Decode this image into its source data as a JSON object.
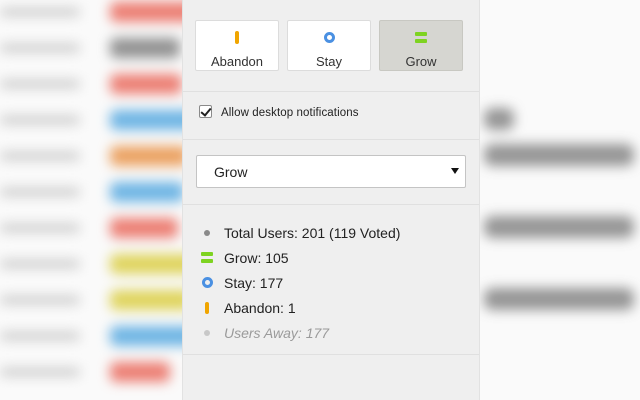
{
  "choices": [
    {
      "id": "abandon",
      "label": "Abandon",
      "icon": "abandon-bar-icon",
      "color": "#f0a500",
      "selected": false
    },
    {
      "id": "stay",
      "label": "Stay",
      "icon": "stay-ring-icon",
      "color": "#4a90e2",
      "selected": false
    },
    {
      "id": "grow",
      "label": "Grow",
      "icon": "grow-double-bar-icon",
      "color": "#7ed321",
      "selected": true
    }
  ],
  "notifications": {
    "label": "Allow desktop notifications",
    "checked": true
  },
  "vote_select": {
    "value": "Grow"
  },
  "stats": {
    "total": "Total Users: 201 (119 Voted)",
    "grow": "Grow: 105",
    "stay": "Stay: 177",
    "abandon": "Abandon: 1",
    "away": "Users Away: 177"
  },
  "colors": {
    "panel": "#efefef",
    "selected_button": "#d6d6d1"
  }
}
